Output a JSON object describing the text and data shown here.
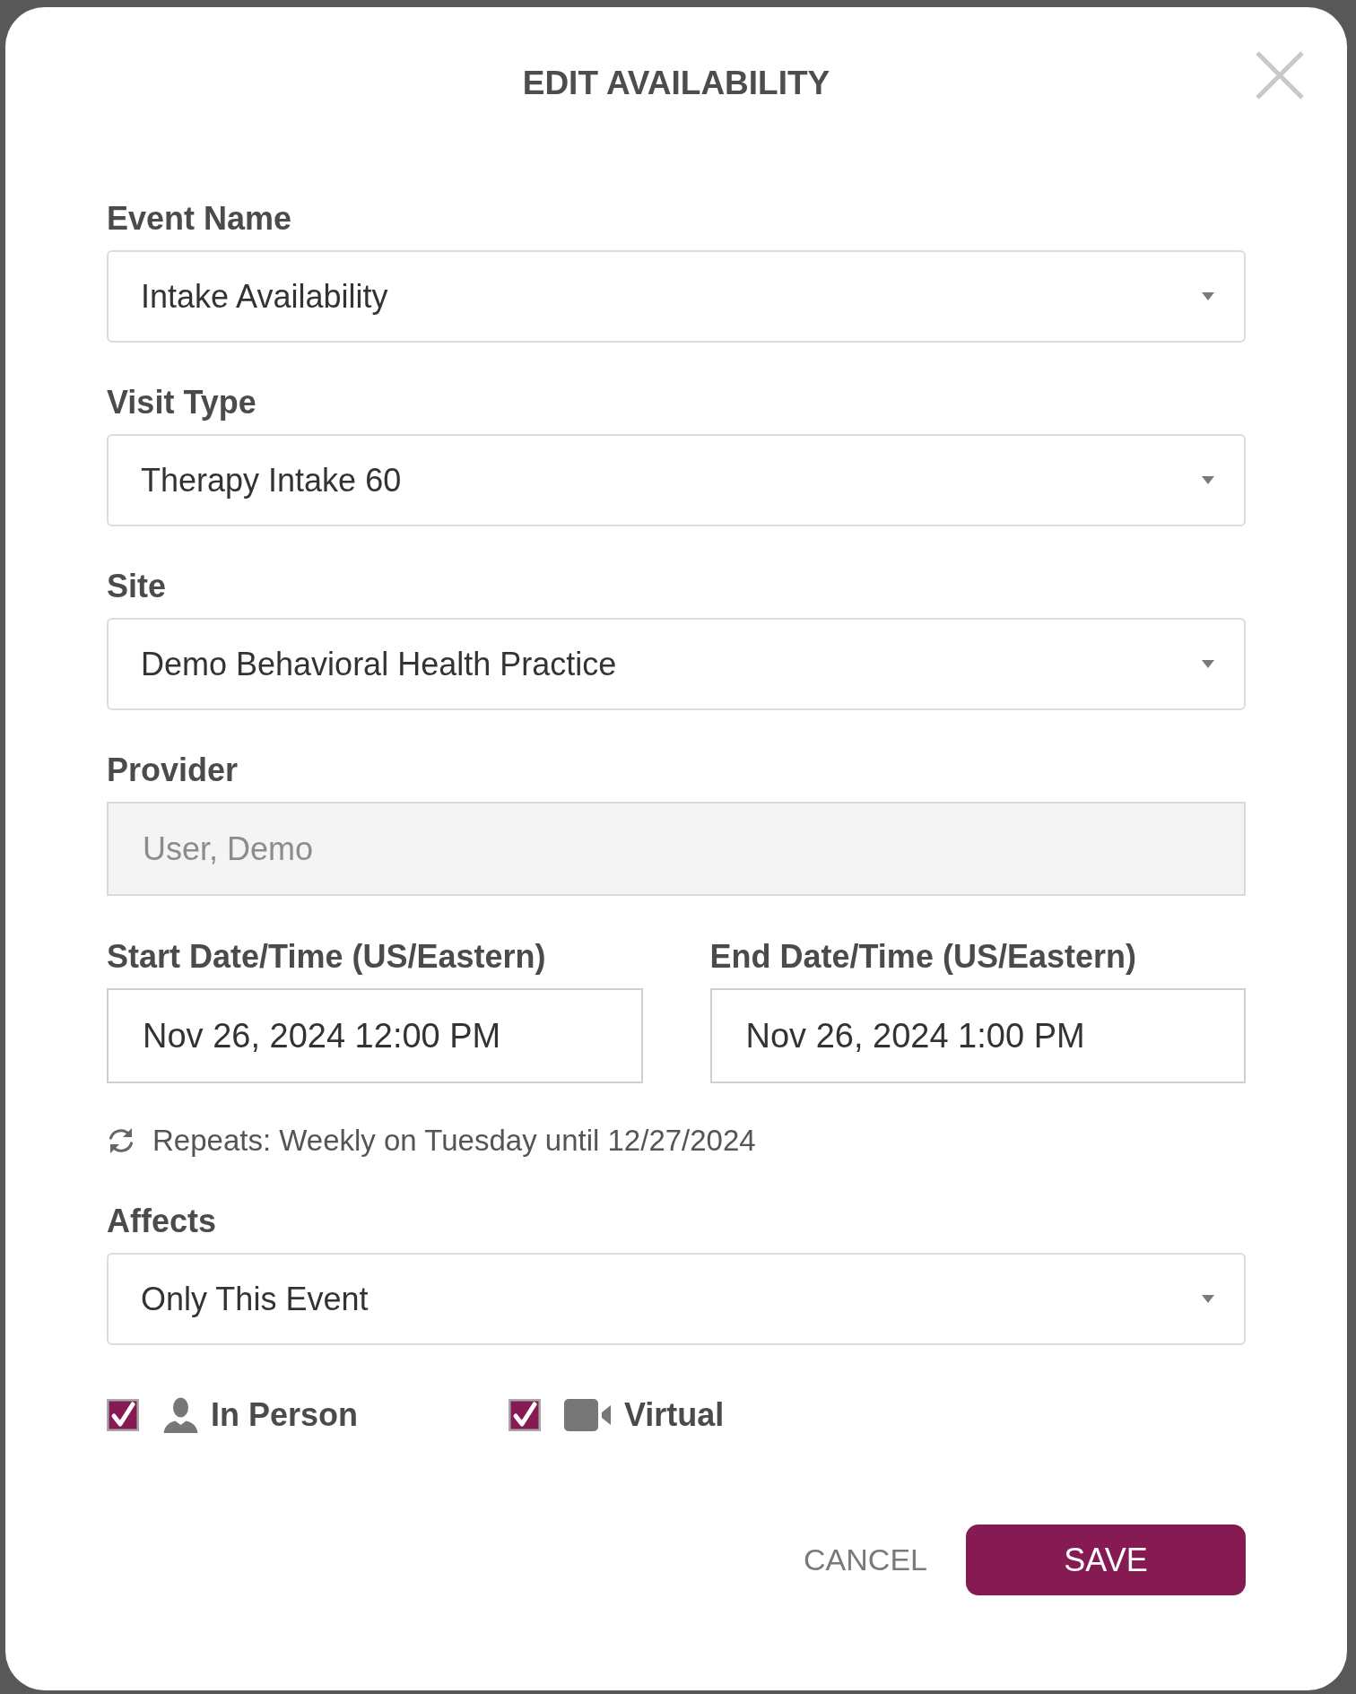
{
  "dialog": {
    "title": "EDIT AVAILABILITY"
  },
  "fields": [
    {
      "kind": "select",
      "label": "Event Name",
      "value": "Intake Availability",
      "disabled": false
    },
    {
      "kind": "select",
      "label": "Visit Type",
      "value": "Therapy Intake 60",
      "disabled": false
    },
    {
      "kind": "select",
      "label": "Site",
      "value": "Demo Behavioral Health Practice",
      "disabled": false
    },
    {
      "kind": "text",
      "label": "Provider",
      "value": "User, Demo",
      "disabled": true
    }
  ],
  "date_range": [
    {
      "label": "Start Date/Time (US/Eastern)",
      "value": "Nov 26, 2024 12:00 PM"
    },
    {
      "label": "End Date/Time (US/Eastern)",
      "value": "Nov 26, 2024 1:00 PM"
    }
  ],
  "recurrence": {
    "text": "Repeats: Weekly on Tuesday until 12/27/2024"
  },
  "affects": {
    "label": "Affects",
    "value": "Only This Event"
  },
  "visit_modes": [
    {
      "kind": "person",
      "label": "In Person",
      "checked": true
    },
    {
      "kind": "video",
      "label": "Virtual",
      "checked": true
    }
  ],
  "buttons": [
    {
      "kind": "text",
      "label": "CANCEL"
    },
    {
      "kind": "primary",
      "label": "SAVE"
    }
  ]
}
